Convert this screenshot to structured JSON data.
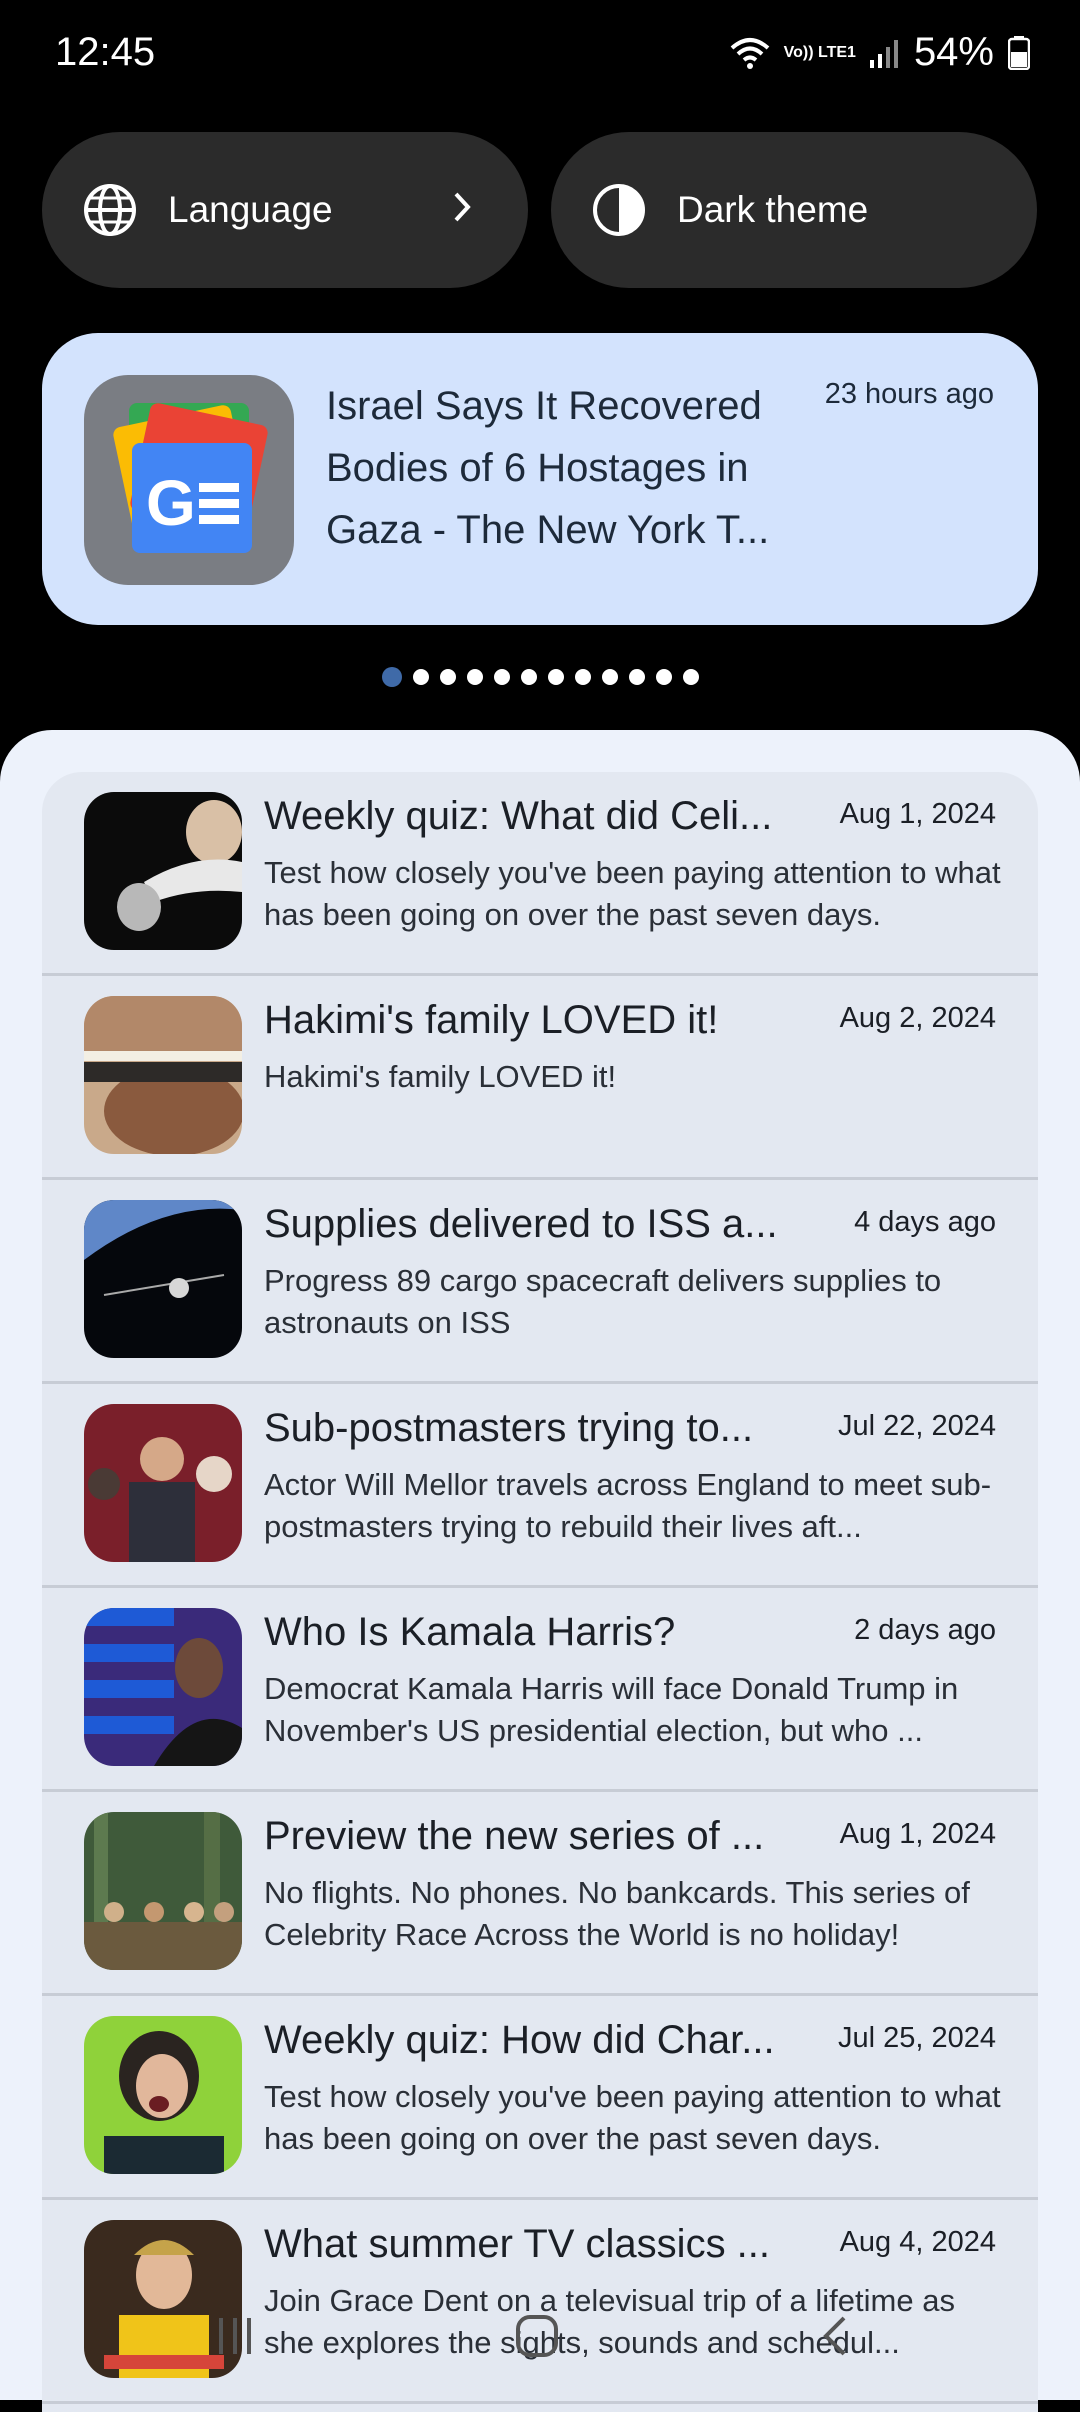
{
  "status_bar": {
    "time": "12:45",
    "network": "Vo)) LTE1",
    "battery": "54%"
  },
  "quick_tiles": {
    "language_label": "Language",
    "dark_theme_label": "Dark theme"
  },
  "headline": {
    "title": "Israel Says It Recovered Bodies of 6 Hostages in Gaza - The New York T...",
    "time": "23 hours ago"
  },
  "pager": {
    "count": 12,
    "active_index": 0
  },
  "articles": [
    {
      "title": "Weekly quiz: What did Celi...",
      "date": "Aug 1, 2024",
      "desc": "Test how closely you've been paying attention to what has been going on over the past seven days."
    },
    {
      "title": "Hakimi's family LOVED it!",
      "date": "Aug 2, 2024",
      "desc": "Hakimi's family LOVED it!"
    },
    {
      "title": "Supplies delivered to ISS a...",
      "date": "4 days ago",
      "desc": "Progress 89 cargo spacecraft delivers supplies to astronauts on ISS"
    },
    {
      "title": "Sub-postmasters trying to...",
      "date": "Jul 22, 2024",
      "desc": "Actor Will Mellor travels across England to meet sub-postmasters trying to rebuild their lives aft..."
    },
    {
      "title": "Who Is Kamala Harris?",
      "date": "2 days ago",
      "desc": "Democrat Kamala Harris will face Donald Trump in November's US presidential election, but who ..."
    },
    {
      "title": "Preview the new series of ...",
      "date": "Aug 1, 2024",
      "desc": "No flights. No phones. No bankcards. This series of Celebrity Race Across the World is no holiday!"
    },
    {
      "title": "Weekly quiz: How did Char...",
      "date": "Jul 25, 2024",
      "desc": "Test how closely you've been paying attention to what has been going on over the past seven days."
    },
    {
      "title": "What summer TV classics ...",
      "date": "Aug 4, 2024",
      "desc": "Join Grace Dent on a televisual trip of a lifetime as she explores the sights, sounds and schedul..."
    }
  ]
}
